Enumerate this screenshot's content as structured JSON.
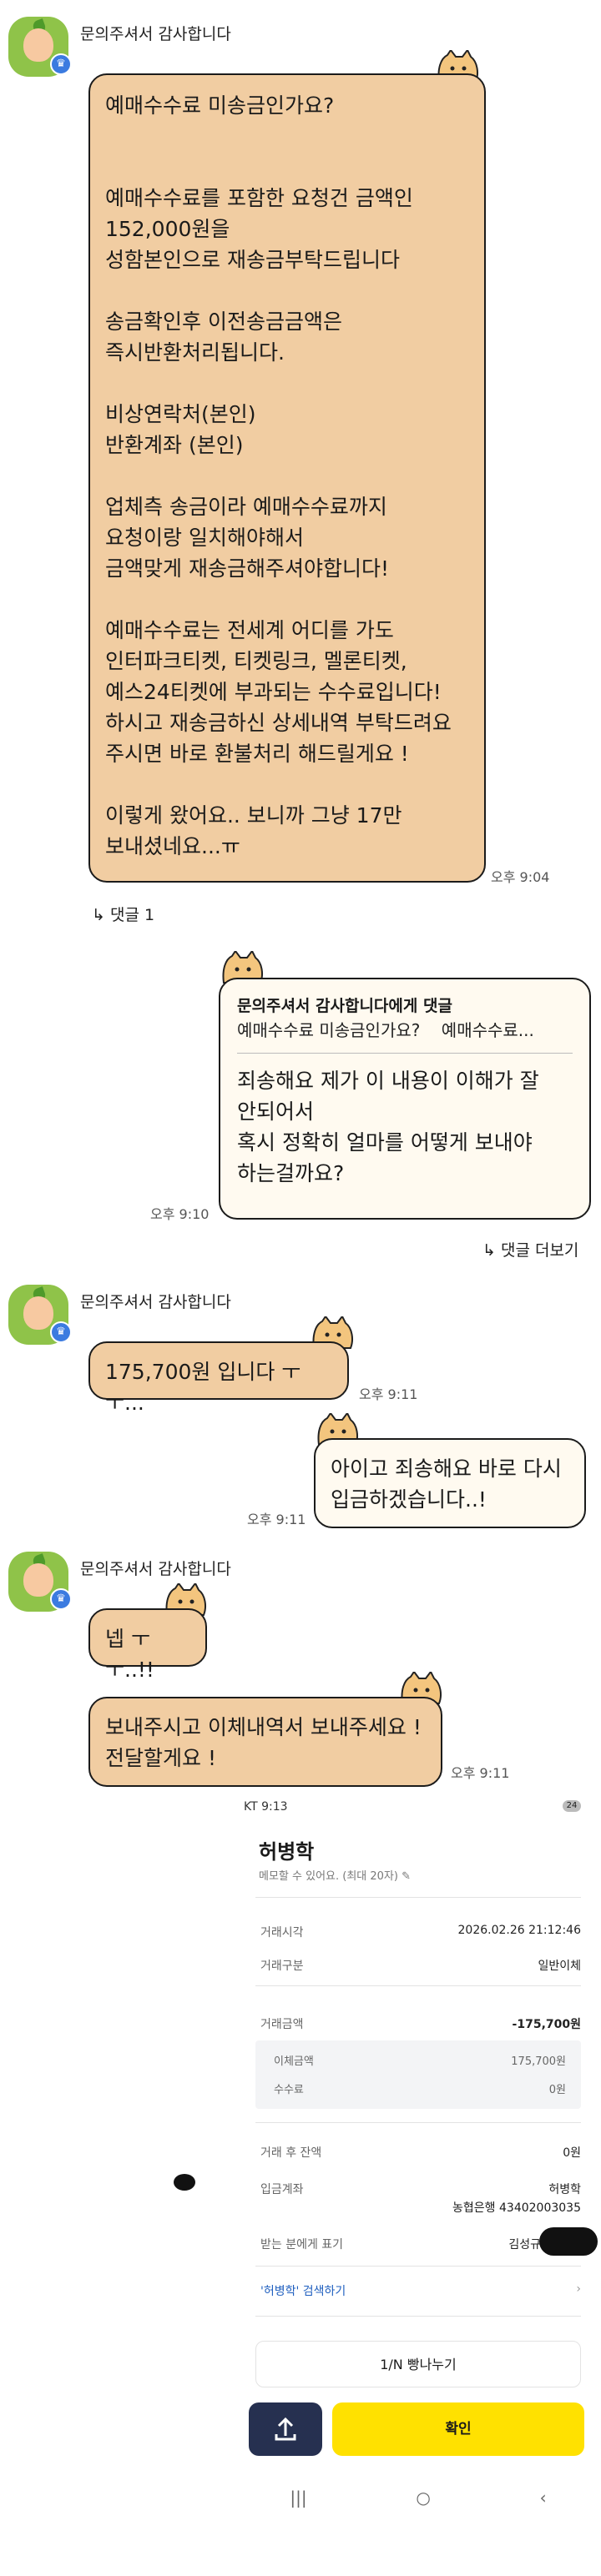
{
  "sender_name": "문의주셔서 감사합니다",
  "msg1": {
    "lines": [
      "예매수수료 미송금인가요?",
      "",
      "",
      "예매수수료를 포함한 요청건 금액인",
      "152,000원을",
      "성함본인으로 재송금부탁드립니다",
      "",
      "송금확인후 이전송금금액은",
      "즉시반환처리됩니다.",
      "",
      "비상연락처(본인)",
      "반환계좌 (본인)",
      "",
      "업체측 송금이라 예매수수료까지",
      "요청이랑 일치해야해서",
      "금액맞게 재송금해주셔야합니다!",
      "",
      "예매수수료는 전세계 어디를 가도",
      "인터파크티켓, 티켓링크, 멜론티켓,",
      "예스24티켓에 부과되는 수수료입니다!",
      "하시고 재송금하신 상세내역 부탁드려요",
      "주시면 바로 환불처리 해드릴게요 !",
      "",
      "이렇게 왔어요.. 보니까 그냥 17만",
      "보내셨네요...ㅠ"
    ],
    "time": "오후 9:04"
  },
  "reply_count": "댓글 1",
  "msg2": {
    "quote_title": "문의주셔서 감사합니다에게 댓글",
    "quote_text": "예매수수료 미송금인가요?    예매수수료...",
    "lines": [
      "죄송해요 제가 이 내용이 이해가 잘",
      "안되어서",
      "혹시 정확히 얼마를 어떻게 보내야",
      "하는걸까요?"
    ],
    "time": "오후 9:10"
  },
  "more_replies": "댓글 더보기",
  "msg3": {
    "text": "175,700원 입니다 ㅜㅜ...",
    "time": "오후 9:11"
  },
  "msg4": {
    "lines": [
      "아이고 죄송해요 바로 다시",
      "입금하겠습니다..!"
    ],
    "time": "오후 9:11"
  },
  "msg5": {
    "text": "넵 ㅜㅜ..!!"
  },
  "msg6": {
    "lines": [
      "보내주시고 이체내역서 보내주세요 !",
      "전달할게요 !"
    ],
    "time": "오후 9:11"
  },
  "phone": {
    "status_time": "KT 9:13",
    "battery": "24",
    "name": "허병학",
    "memo_placeholder": "메모할 수 있어요. (최대 20자)",
    "rows": {
      "time_label": "거래시각",
      "time_value": "2026.02.26 21:12:46",
      "type_label": "거래구분",
      "type_value": "일반이체",
      "amount_label": "거래금액",
      "amount_value": "-175,700원",
      "transfer_label": "이체금액",
      "transfer_value": "175,700원",
      "fee_label": "수수료",
      "fee_value": "0원",
      "balance_label": "거래 후 잔액",
      "balance_value": "0원",
      "account_label": "입금계좌",
      "account_name": "허병학",
      "account_value": "농협은행 43402003035",
      "display_label": "받는 분에게 표기",
      "display_value": "김성규"
    },
    "search_link": "'허병학' 검색하기",
    "split_button": "1/N 빵나누기",
    "confirm_button": "확인"
  },
  "colors": {
    "peach_bubble": "#f1cda2",
    "cream_bubble": "#fffaf0",
    "confirm_yellow": "#ffe100",
    "share_button": "#263050"
  }
}
